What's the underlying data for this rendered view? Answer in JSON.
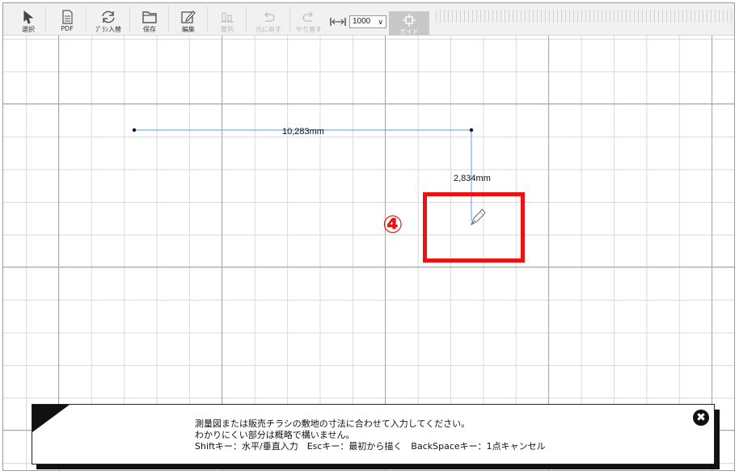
{
  "toolbar": {
    "tools": [
      {
        "label": "選択",
        "icon": "select-arrow-icon"
      },
      {
        "label": "PDF",
        "icon": "pdf-document-icon"
      },
      {
        "label": "ﾌﾟﾗﾝ入替",
        "icon": "refresh-icon"
      },
      {
        "label": "保存",
        "icon": "folder-icon"
      },
      {
        "label": "編集",
        "icon": "edit-icon"
      },
      {
        "label": "整列",
        "icon": "align-icon"
      },
      {
        "label": "元に戻す",
        "icon": "undo-icon"
      },
      {
        "label": "やり直す",
        "icon": "redo-icon"
      }
    ],
    "zoom_value": "1000",
    "guide_label": "ガイド"
  },
  "canvas": {
    "segment_horizontal_label": "10,283mm",
    "segment_vertical_label": "2,834mm",
    "line_color": "#5aa0d8"
  },
  "annotation": {
    "number": "④",
    "color": "#ee1111"
  },
  "message": {
    "line1": "測量図または販売チラシの敷地の寸法に合わせて入力してください。",
    "line2": "わかりにくい部分は概略で構いません。",
    "line3": "Shiftキー：水平/垂直入力　Escキー：最初から描く　BackSpaceキー：1点キャンセル",
    "close_icon": "✖"
  }
}
